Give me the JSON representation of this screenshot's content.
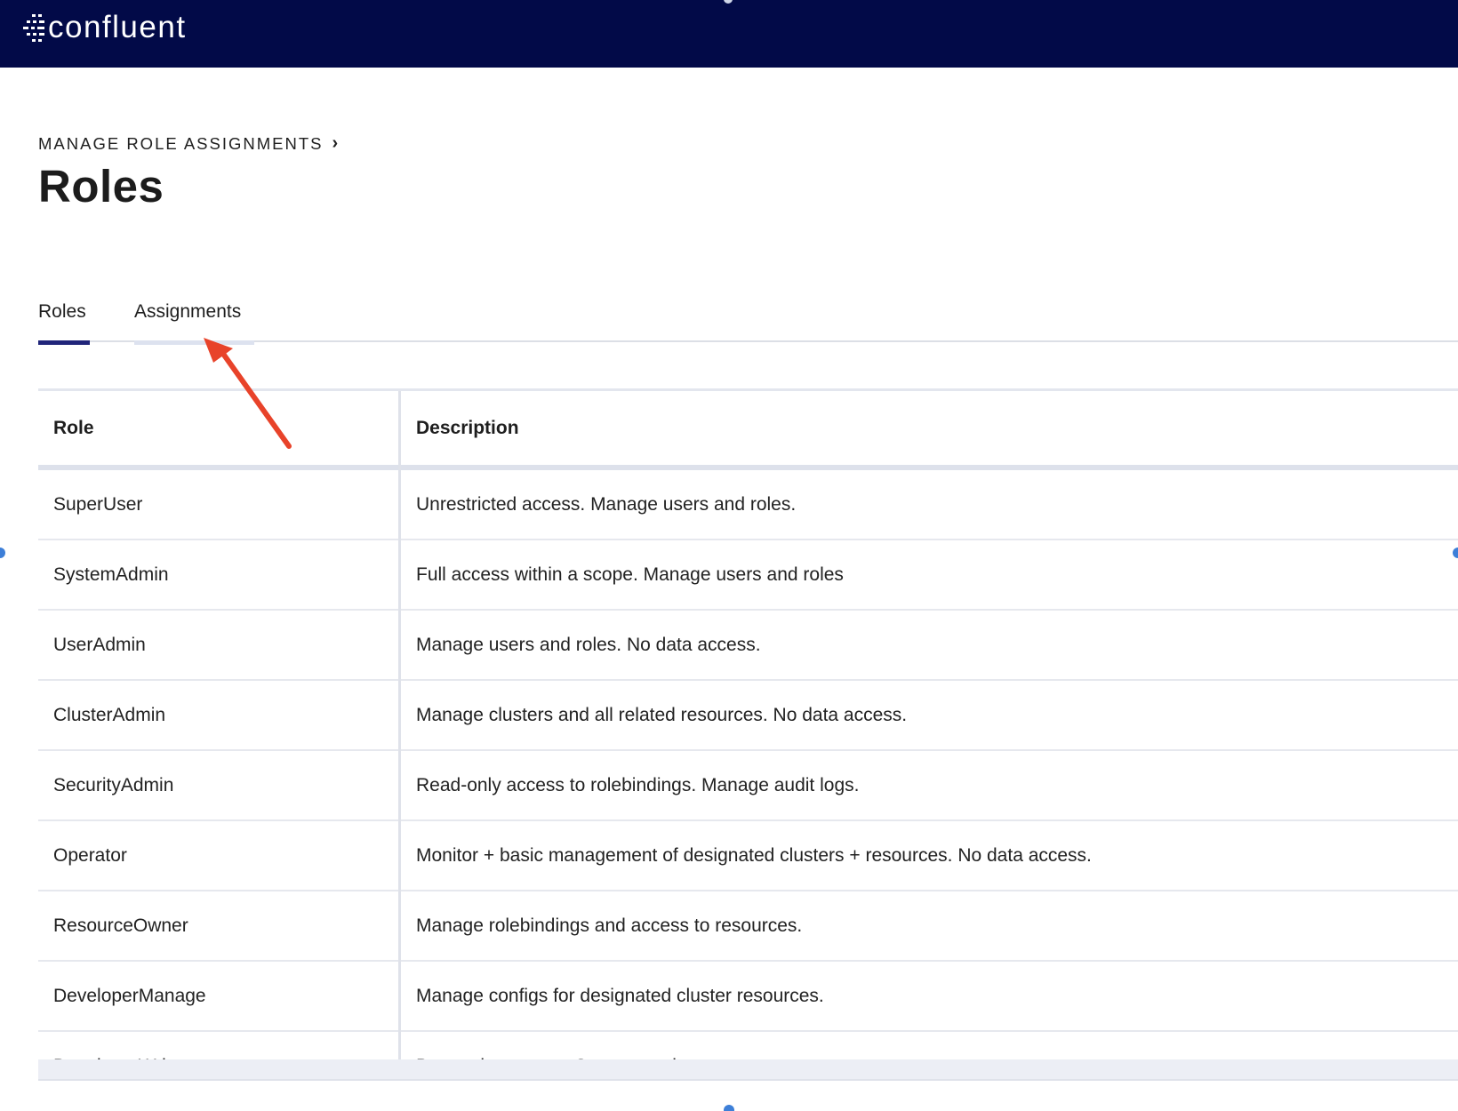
{
  "brand": {
    "logo_text": "confluent",
    "colors": {
      "topbar": "#020a48",
      "tab_active": "#20257a",
      "annotation": "#e8432a"
    }
  },
  "breadcrumb": {
    "label": "MANAGE ROLE ASSIGNMENTS",
    "chevron": "›"
  },
  "page": {
    "title": "Roles"
  },
  "tabs": [
    {
      "label": "Roles",
      "active": true
    },
    {
      "label": "Assignments",
      "active": false
    }
  ],
  "table": {
    "headers": {
      "role": "Role",
      "description": "Description"
    },
    "rows": [
      {
        "role": "SuperUser",
        "description": "Unrestricted access. Manage users and roles."
      },
      {
        "role": "SystemAdmin",
        "description": "Full access within a scope. Manage users and roles"
      },
      {
        "role": "UserAdmin",
        "description": "Manage users and roles. No data access."
      },
      {
        "role": "ClusterAdmin",
        "description": "Manage clusters and all related resources. No data access."
      },
      {
        "role": "SecurityAdmin",
        "description": "Read-only access to rolebindings. Manage audit logs."
      },
      {
        "role": "Operator",
        "description": "Monitor + basic management of designated clusters + resources. No data access."
      },
      {
        "role": "ResourceOwner",
        "description": "Manage rolebindings and access to resources."
      },
      {
        "role": "DeveloperManage",
        "description": "Manage configs for designated cluster resources."
      },
      {
        "role": "DeveloperWrite",
        "description": "Data write access. Cannot read."
      }
    ]
  },
  "annotation": {
    "icon": "red-arrow-pointing-to-assignments-tab"
  }
}
